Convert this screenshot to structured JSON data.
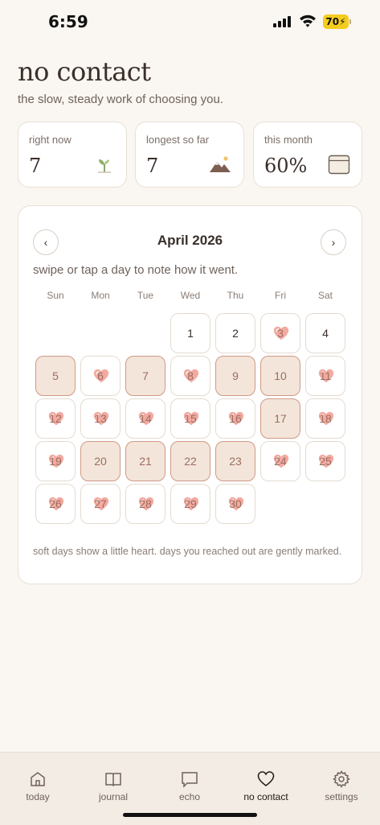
{
  "status_bar": {
    "time": "6:59",
    "battery": "70"
  },
  "header": {
    "title": "no contact",
    "subtitle": "the slow, steady work of choosing you."
  },
  "stats": [
    {
      "label": "right now",
      "value": "7",
      "icon": "sprout-icon"
    },
    {
      "label": "longest so far",
      "value": "7",
      "icon": "mountain-icon"
    },
    {
      "label": "this month",
      "value": "60%",
      "icon": "calendar-icon"
    }
  ],
  "calendar": {
    "month_label": "April 2026",
    "prev_label": "‹",
    "next_label": "›",
    "hint": "swipe or tap a day to note how it went.",
    "weekdays": [
      "Sun",
      "Mon",
      "Tue",
      "Wed",
      "Thu",
      "Fri",
      "Sat"
    ],
    "first_weekday_index": 3,
    "days": [
      {
        "n": "1",
        "state": "plain"
      },
      {
        "n": "2",
        "state": "plain"
      },
      {
        "n": "3",
        "state": "heart"
      },
      {
        "n": "4",
        "state": "plain"
      },
      {
        "n": "5",
        "state": "marked"
      },
      {
        "n": "6",
        "state": "heart"
      },
      {
        "n": "7",
        "state": "marked"
      },
      {
        "n": "8",
        "state": "heart"
      },
      {
        "n": "9",
        "state": "marked"
      },
      {
        "n": "10",
        "state": "marked"
      },
      {
        "n": "11",
        "state": "heart"
      },
      {
        "n": "12",
        "state": "heart"
      },
      {
        "n": "13",
        "state": "heart"
      },
      {
        "n": "14",
        "state": "heart"
      },
      {
        "n": "15",
        "state": "heart"
      },
      {
        "n": "16",
        "state": "heart"
      },
      {
        "n": "17",
        "state": "marked"
      },
      {
        "n": "18",
        "state": "heart"
      },
      {
        "n": "19",
        "state": "heart"
      },
      {
        "n": "20",
        "state": "marked"
      },
      {
        "n": "21",
        "state": "marked"
      },
      {
        "n": "22",
        "state": "marked"
      },
      {
        "n": "23",
        "state": "marked"
      },
      {
        "n": "24",
        "state": "heart"
      },
      {
        "n": "25",
        "state": "heart"
      },
      {
        "n": "26",
        "state": "heart"
      },
      {
        "n": "27",
        "state": "heart"
      },
      {
        "n": "28",
        "state": "heart"
      },
      {
        "n": "29",
        "state": "heart"
      },
      {
        "n": "30",
        "state": "heart"
      }
    ],
    "footnote": "soft days show a little heart. days you reached out are gently marked."
  },
  "tabs": [
    {
      "label": "today",
      "icon": "home-icon",
      "active": false
    },
    {
      "label": "journal",
      "icon": "book-icon",
      "active": false
    },
    {
      "label": "echo",
      "icon": "chat-icon",
      "active": false
    },
    {
      "label": "no contact",
      "icon": "heart-icon",
      "active": true
    },
    {
      "label": "settings",
      "icon": "gear-icon",
      "active": false
    }
  ],
  "colors": {
    "background": "#faf6f1",
    "marked_fill": "#f3e5da",
    "marked_border": "#cf9a86",
    "heart": "#f0a9a0",
    "text": "#3a2f2a"
  }
}
